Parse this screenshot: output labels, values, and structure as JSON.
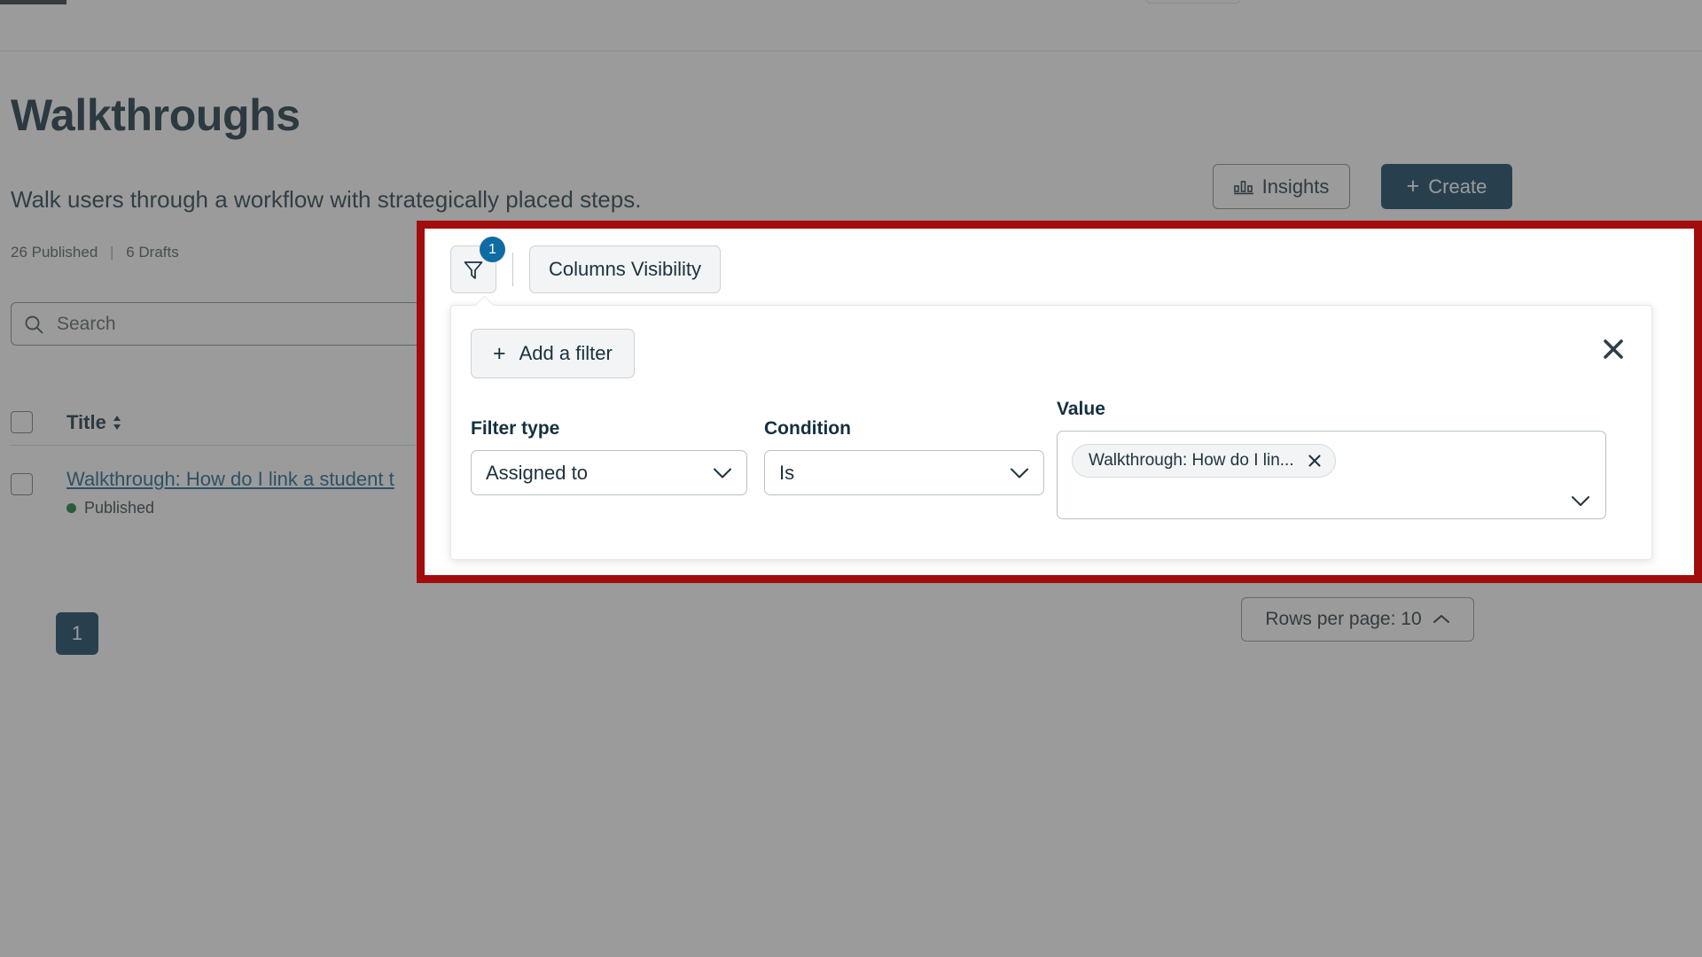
{
  "page": {
    "title": "Walkthroughs",
    "subtitle": "Walk users through a workflow with strategically placed steps.",
    "counts": {
      "published": "26 Published",
      "separator": "|",
      "drafts": "6 Drafts"
    },
    "actions": {
      "insights_label": "Insights",
      "create_label": "Create",
      "create_plus": "+"
    },
    "search": {
      "placeholder": "Search",
      "value": ""
    },
    "table": {
      "columns": [
        {
          "label": "Title",
          "sort_glyph": "↕"
        }
      ],
      "rows": [
        {
          "title": "Walkthrough: How do I link a student t",
          "status": "Published",
          "status_color": "#0f7a2e"
        }
      ]
    },
    "pagination": {
      "current_page": "1",
      "rows_per_page_label": "Rows per page: 10"
    }
  },
  "toolbar": {
    "filter_badge_count": "1",
    "columns_visibility_label": "Columns Visibility"
  },
  "filter_panel": {
    "add_filter_label": "Add a filter",
    "add_filter_plus": "+",
    "fields": {
      "filter_type": {
        "label": "Filter type",
        "value": "Assigned to"
      },
      "condition": {
        "label": "Condition",
        "value": "Is"
      },
      "value": {
        "label": "Value",
        "chips": [
          {
            "text": "Walkthrough: How do I lin..."
          }
        ]
      }
    }
  },
  "colors": {
    "highlight_border": "#a30c0c",
    "brand_navy": "#0b3e5d",
    "badge_blue": "#0e6ca3",
    "link_blue": "#16628f",
    "status_green": "#0f7a2e",
    "trash_red": "#e8232a",
    "scrim": "rgba(66,66,66,0.53)"
  }
}
